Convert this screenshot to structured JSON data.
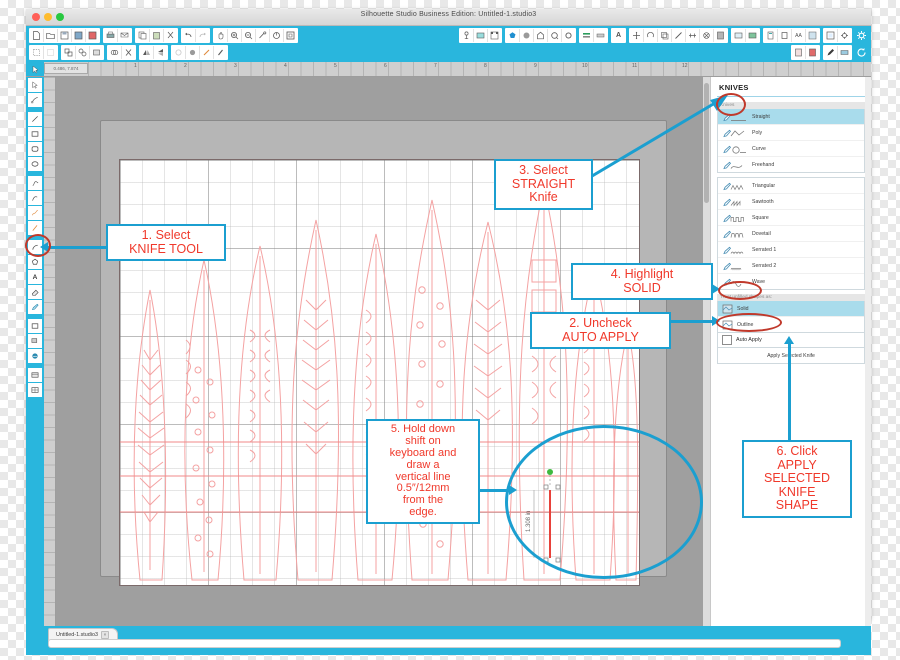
{
  "window": {
    "title": "Silhouette Studio Business Edition: Untitled-1.studio3",
    "traffic_lights": [
      "close",
      "minimize",
      "zoom"
    ]
  },
  "toolbar_top": {
    "row1_groups": [
      {
        "icons": [
          "new-document-icon",
          "open-folder-icon",
          "save-icon",
          "save-as-icon",
          "save-all-icon"
        ]
      },
      {
        "icons": [
          "print-icon",
          "send-icon"
        ]
      },
      {
        "icons": [
          "copy-icon",
          "paste-icon",
          "cut-icon"
        ]
      },
      {
        "icons": [
          "undo-icon",
          "redo-icon"
        ]
      },
      {
        "icons": [
          "pan-icon",
          "zoom-in-icon",
          "zoom-out-icon",
          "zoom-selection-icon",
          "zoom-reset-icon",
          "fit-to-window-icon"
        ]
      }
    ],
    "row2_groups": [
      {
        "icons": [
          "select-all-icon",
          "deselect-all-icon"
        ]
      },
      {
        "icons": [
          "group-icon",
          "ungroup-icon",
          "compound-path-icon"
        ]
      },
      {
        "icons": [
          "weld-icon",
          "crop-icon"
        ]
      },
      {
        "icons": [
          "mirror-horizontal-icon",
          "mirror-vertical-icon"
        ]
      },
      {
        "icons": [
          "align-icon",
          "replicate-icon",
          "offset-icon",
          "trace-icon"
        ]
      }
    ],
    "right_groups": [
      {
        "icons": [
          "page-setup-icon",
          "cut-settings-icon",
          "registration-marks-icon"
        ]
      },
      {
        "icons": [
          "fill-color-icon",
          "fill-gradient-icon",
          "fill-pattern-icon",
          "transparency-icon",
          "line-style-icon"
        ]
      },
      {
        "icons": [
          "line-color-icon",
          "line-thickness-icon"
        ]
      },
      {
        "icons": [
          "text-style-icon"
        ]
      },
      {
        "icons": [
          "transform-icon",
          "modify-icon",
          "offset-panel-icon",
          "knife-panel-icon",
          "trace-panel-icon",
          "rhinestone-icon",
          "sketch-icon"
        ]
      },
      {
        "icons": [
          "library-icon",
          "store-icon"
        ]
      },
      {
        "icons": [
          "send-panel-icon",
          "cutter-icon",
          "aa-icon",
          "layers-icon"
        ]
      },
      {
        "icons": [
          "design-page-icon",
          "settings-icon"
        ]
      }
    ],
    "right_extra": [
      "preferences-gear-icon",
      "refresh-icon",
      "print-preview-icon",
      "my-library-icon",
      "pen-icon",
      "send-to-cutter-icon"
    ]
  },
  "rulers": {
    "unit": "in",
    "coordinate_readout": "0.486, 7.874",
    "horizontal_ticks": [
      "1",
      "2",
      "3",
      "4",
      "5",
      "6",
      "7",
      "8",
      "9",
      "10",
      "11",
      "12"
    ]
  },
  "left_toolbar": {
    "tools": [
      {
        "name": "select-tool",
        "glyph": "arrow"
      },
      {
        "name": "edit-points-tool",
        "glyph": "node"
      },
      {
        "name": "line-tool",
        "glyph": "line"
      },
      {
        "name": "rectangle-tool",
        "glyph": "rect"
      },
      {
        "name": "rounded-rectangle-tool",
        "glyph": "rrect"
      },
      {
        "name": "ellipse-tool",
        "glyph": "ellipse"
      },
      {
        "name": "polygon-tool",
        "glyph": "polygon"
      },
      {
        "name": "curve-tool",
        "glyph": "curve"
      },
      {
        "name": "freehand-tool",
        "glyph": "freehand"
      },
      {
        "name": "smooth-freehand-tool",
        "glyph": "smooth"
      },
      {
        "name": "arc-tool",
        "glyph": "arc"
      },
      {
        "name": "regular-polygon-tool",
        "glyph": "hexagon"
      },
      {
        "name": "text-tool",
        "glyph": "A"
      },
      {
        "name": "eraser-tool",
        "glyph": "eraser"
      },
      {
        "name": "knife-tool",
        "glyph": "knife",
        "highlighted": true
      },
      {
        "name": "fill-tool",
        "glyph": "fill"
      },
      {
        "name": "shadow-tool",
        "glyph": "shadow"
      },
      {
        "name": "eyedropper-tool",
        "glyph": "dropper"
      },
      {
        "name": "page-tool",
        "glyph": "page"
      },
      {
        "name": "grid-tool",
        "glyph": "grid"
      }
    ]
  },
  "canvas": {
    "mat_label": "cutting-mat",
    "selection_measurement": "1.308 in",
    "arrow_indicator": "load-direction-arrow"
  },
  "knives_panel": {
    "title": "KNIVES",
    "section_knives_label": "Knives",
    "knife_types": [
      {
        "label": "Straight",
        "selected": true
      },
      {
        "label": "Poly",
        "selected": false
      },
      {
        "label": "Curve",
        "selected": false
      },
      {
        "label": "Freehand",
        "selected": false
      }
    ],
    "knife_shapes": [
      {
        "label": "Triangular"
      },
      {
        "label": "Sawtooth"
      },
      {
        "label": "Square"
      },
      {
        "label": "Dovetail"
      },
      {
        "label": "Serrated 1"
      },
      {
        "label": "Serrated 2"
      },
      {
        "label": "Wave"
      }
    ],
    "treat_label": "Treat unfilled shapes as:",
    "fill_options": [
      {
        "label": "Solid",
        "selected": true
      },
      {
        "label": "Outline",
        "selected": false
      }
    ],
    "auto_apply": {
      "label": "Auto Apply",
      "checked": false
    },
    "apply_button": "Apply Selected Knife"
  },
  "bottom_bar": {
    "document_tab": "Untitled-1.studio3",
    "tab_close": "×"
  },
  "annotations": [
    {
      "id": "step1",
      "text": "1. Select\nKNIFE TOOL",
      "lines": [
        "1. Select",
        "KNIFE TOOL"
      ]
    },
    {
      "id": "step2",
      "text": "2. Uncheck\nAUTO APPLY",
      "lines": [
        "2. Uncheck",
        "AUTO APPLY"
      ]
    },
    {
      "id": "step3",
      "text": "3. Select\nSTRAIGHT\nKnife",
      "lines": [
        "3. Select",
        "STRAIGHT",
        "Knife"
      ]
    },
    {
      "id": "step4",
      "text": "4. Highlight\nSOLID",
      "lines": [
        "4. Highlight",
        "SOLID"
      ]
    },
    {
      "id": "step5",
      "text": "5. Hold down shift on keyboard and draw a vertical line 0.5\"/12mm from the edge.",
      "lines": [
        "5. Hold down",
        "shift on",
        "keyboard and",
        "draw a",
        "vertical line",
        "0.5″/12mm",
        "from the",
        "edge."
      ]
    },
    {
      "id": "step6",
      "text": "6. Click APPLY SELECTED KNIFE SHAPE",
      "lines": [
        "6. Click",
        "APPLY",
        "SELECTED",
        "KNIFE",
        "SHAPE"
      ]
    }
  ],
  "colors": {
    "accent_blue": "#29b6dd",
    "annotation_blue": "#1b9fd0",
    "annotation_red": "#f0392b",
    "highlight_ellipse": "#c0392b",
    "selected_row": "#a9dcec",
    "design_stroke": "#f4a2a2"
  }
}
